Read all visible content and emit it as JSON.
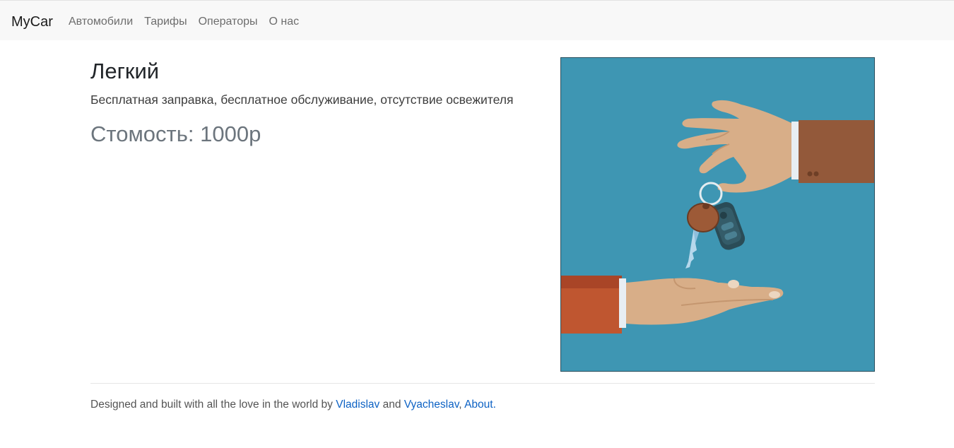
{
  "navbar": {
    "brand": "MyCar",
    "links": [
      "Автомобили",
      "Тарифы",
      "Операторы",
      "О нас"
    ]
  },
  "tariff": {
    "name": "Легкий",
    "description": "Бесплатная заправка, бесплатное обслуживание, отсутствие освежителя",
    "price": "Стомость: 1000р"
  },
  "hero": {
    "icon": "car-keys-handover-illustration",
    "background_color": "#3e96b3"
  },
  "footer": {
    "text_prefix": "Designed and built with all the love in the world by ",
    "author1": "Vladislav",
    "text_and": " and ",
    "author2": "Vyacheslav",
    "text_comma": ", ",
    "about": "About."
  },
  "colors": {
    "link": "#0d62c4",
    "navbar_bg": "#f8f8f8"
  }
}
